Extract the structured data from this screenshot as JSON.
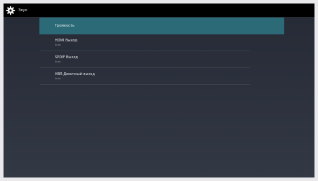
{
  "header": {
    "title": "Звук",
    "icon": "gear-icon"
  },
  "list": {
    "selected": {
      "label": "Громкость"
    },
    "items": [
      {
        "label": "HDMI Выход",
        "value": "Auto"
      },
      {
        "label": "SPDIF Выход",
        "value": "Auto"
      },
      {
        "label": "HBR Двоичный выход",
        "value": "Auto"
      }
    ]
  },
  "colors": {
    "highlight": "#2b6a76",
    "background": "#2b303c",
    "statusbar": "#000000"
  }
}
